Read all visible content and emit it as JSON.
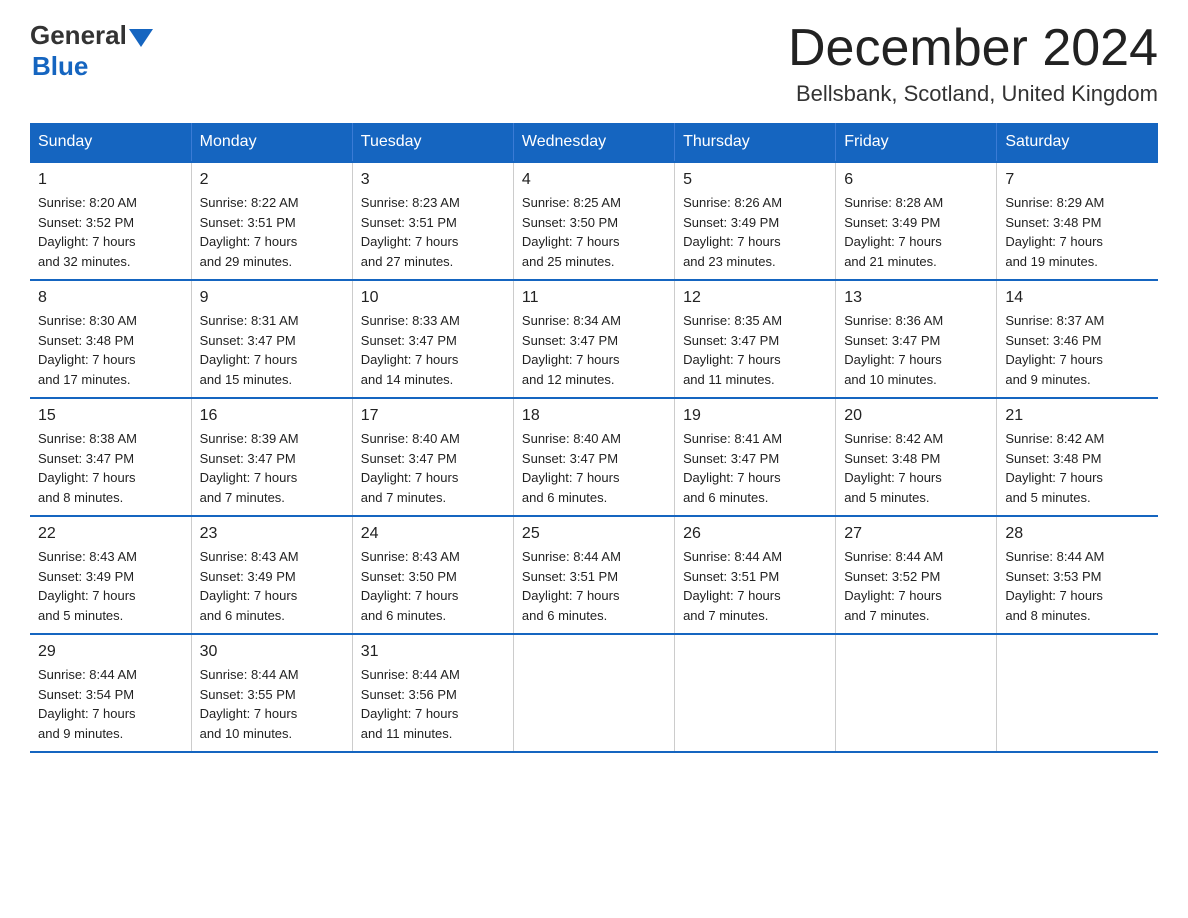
{
  "logo": {
    "general": "General",
    "blue": "Blue"
  },
  "title": "December 2024",
  "location": "Bellsbank, Scotland, United Kingdom",
  "weekdays": [
    "Sunday",
    "Monday",
    "Tuesday",
    "Wednesday",
    "Thursday",
    "Friday",
    "Saturday"
  ],
  "weeks": [
    [
      {
        "day": "1",
        "sunrise": "8:20 AM",
        "sunset": "3:52 PM",
        "daylight": "7 hours and 32 minutes."
      },
      {
        "day": "2",
        "sunrise": "8:22 AM",
        "sunset": "3:51 PM",
        "daylight": "7 hours and 29 minutes."
      },
      {
        "day": "3",
        "sunrise": "8:23 AM",
        "sunset": "3:51 PM",
        "daylight": "7 hours and 27 minutes."
      },
      {
        "day": "4",
        "sunrise": "8:25 AM",
        "sunset": "3:50 PM",
        "daylight": "7 hours and 25 minutes."
      },
      {
        "day": "5",
        "sunrise": "8:26 AM",
        "sunset": "3:49 PM",
        "daylight": "7 hours and 23 minutes."
      },
      {
        "day": "6",
        "sunrise": "8:28 AM",
        "sunset": "3:49 PM",
        "daylight": "7 hours and 21 minutes."
      },
      {
        "day": "7",
        "sunrise": "8:29 AM",
        "sunset": "3:48 PM",
        "daylight": "7 hours and 19 minutes."
      }
    ],
    [
      {
        "day": "8",
        "sunrise": "8:30 AM",
        "sunset": "3:48 PM",
        "daylight": "7 hours and 17 minutes."
      },
      {
        "day": "9",
        "sunrise": "8:31 AM",
        "sunset": "3:47 PM",
        "daylight": "7 hours and 15 minutes."
      },
      {
        "day": "10",
        "sunrise": "8:33 AM",
        "sunset": "3:47 PM",
        "daylight": "7 hours and 14 minutes."
      },
      {
        "day": "11",
        "sunrise": "8:34 AM",
        "sunset": "3:47 PM",
        "daylight": "7 hours and 12 minutes."
      },
      {
        "day": "12",
        "sunrise": "8:35 AM",
        "sunset": "3:47 PM",
        "daylight": "7 hours and 11 minutes."
      },
      {
        "day": "13",
        "sunrise": "8:36 AM",
        "sunset": "3:47 PM",
        "daylight": "7 hours and 10 minutes."
      },
      {
        "day": "14",
        "sunrise": "8:37 AM",
        "sunset": "3:46 PM",
        "daylight": "7 hours and 9 minutes."
      }
    ],
    [
      {
        "day": "15",
        "sunrise": "8:38 AM",
        "sunset": "3:47 PM",
        "daylight": "7 hours and 8 minutes."
      },
      {
        "day": "16",
        "sunrise": "8:39 AM",
        "sunset": "3:47 PM",
        "daylight": "7 hours and 7 minutes."
      },
      {
        "day": "17",
        "sunrise": "8:40 AM",
        "sunset": "3:47 PM",
        "daylight": "7 hours and 7 minutes."
      },
      {
        "day": "18",
        "sunrise": "8:40 AM",
        "sunset": "3:47 PM",
        "daylight": "7 hours and 6 minutes."
      },
      {
        "day": "19",
        "sunrise": "8:41 AM",
        "sunset": "3:47 PM",
        "daylight": "7 hours and 6 minutes."
      },
      {
        "day": "20",
        "sunrise": "8:42 AM",
        "sunset": "3:48 PM",
        "daylight": "7 hours and 5 minutes."
      },
      {
        "day": "21",
        "sunrise": "8:42 AM",
        "sunset": "3:48 PM",
        "daylight": "7 hours and 5 minutes."
      }
    ],
    [
      {
        "day": "22",
        "sunrise": "8:43 AM",
        "sunset": "3:49 PM",
        "daylight": "7 hours and 5 minutes."
      },
      {
        "day": "23",
        "sunrise": "8:43 AM",
        "sunset": "3:49 PM",
        "daylight": "7 hours and 6 minutes."
      },
      {
        "day": "24",
        "sunrise": "8:43 AM",
        "sunset": "3:50 PM",
        "daylight": "7 hours and 6 minutes."
      },
      {
        "day": "25",
        "sunrise": "8:44 AM",
        "sunset": "3:51 PM",
        "daylight": "7 hours and 6 minutes."
      },
      {
        "day": "26",
        "sunrise": "8:44 AM",
        "sunset": "3:51 PM",
        "daylight": "7 hours and 7 minutes."
      },
      {
        "day": "27",
        "sunrise": "8:44 AM",
        "sunset": "3:52 PM",
        "daylight": "7 hours and 7 minutes."
      },
      {
        "day": "28",
        "sunrise": "8:44 AM",
        "sunset": "3:53 PM",
        "daylight": "7 hours and 8 minutes."
      }
    ],
    [
      {
        "day": "29",
        "sunrise": "8:44 AM",
        "sunset": "3:54 PM",
        "daylight": "7 hours and 9 minutes."
      },
      {
        "day": "30",
        "sunrise": "8:44 AM",
        "sunset": "3:55 PM",
        "daylight": "7 hours and 10 minutes."
      },
      {
        "day": "31",
        "sunrise": "8:44 AM",
        "sunset": "3:56 PM",
        "daylight": "7 hours and 11 minutes."
      },
      null,
      null,
      null,
      null
    ]
  ],
  "labels": {
    "sunrise": "Sunrise:",
    "sunset": "Sunset:",
    "daylight": "Daylight:"
  }
}
